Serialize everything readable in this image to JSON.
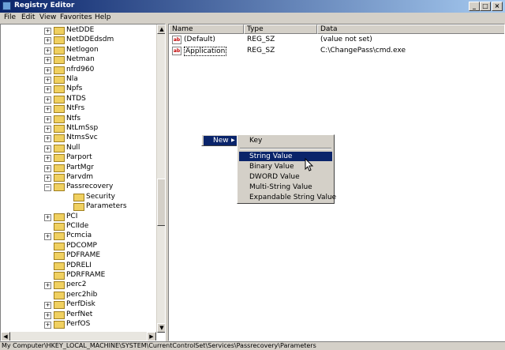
{
  "window": {
    "title": "Registry Editor",
    "minimize": "_",
    "maximize": "□",
    "close": "×"
  },
  "menu": {
    "file": "File",
    "edit": "Edit",
    "view": "View",
    "favorites": "Favorites",
    "help": "Help"
  },
  "tree": {
    "items": [
      {
        "label": "NetDDE",
        "exp": "+"
      },
      {
        "label": "NetDDEdsdm",
        "exp": "+"
      },
      {
        "label": "Netlogon",
        "exp": "+"
      },
      {
        "label": "Netman",
        "exp": "+"
      },
      {
        "label": "nfrd960",
        "exp": "+"
      },
      {
        "label": "Nla",
        "exp": "+"
      },
      {
        "label": "Npfs",
        "exp": "+"
      },
      {
        "label": "NTDS",
        "exp": "+"
      },
      {
        "label": "NtFrs",
        "exp": "+"
      },
      {
        "label": "Ntfs",
        "exp": "+"
      },
      {
        "label": "NtLmSsp",
        "exp": "+"
      },
      {
        "label": "NtmsSvc",
        "exp": "+"
      },
      {
        "label": "Null",
        "exp": "+"
      },
      {
        "label": "Parport",
        "exp": "+"
      },
      {
        "label": "PartMgr",
        "exp": "+"
      },
      {
        "label": "Parvdm",
        "exp": "+"
      },
      {
        "label": "Passrecovery",
        "exp": "−"
      },
      {
        "label": "Security",
        "exp": ""
      },
      {
        "label": "Parameters",
        "exp": ""
      },
      {
        "label": "PCI",
        "exp": "+"
      },
      {
        "label": "PCIIde",
        "exp": ""
      },
      {
        "label": "Pcmcia",
        "exp": "+"
      },
      {
        "label": "PDCOMP",
        "exp": ""
      },
      {
        "label": "PDFRAME",
        "exp": ""
      },
      {
        "label": "PDRELI",
        "exp": ""
      },
      {
        "label": "PDRFRAME",
        "exp": ""
      },
      {
        "label": "perc2",
        "exp": "+"
      },
      {
        "label": "perc2hib",
        "exp": ""
      },
      {
        "label": "PerfDisk",
        "exp": "+"
      },
      {
        "label": "PerfNet",
        "exp": "+"
      },
      {
        "label": "PerfOS",
        "exp": "+"
      }
    ]
  },
  "list": {
    "headers": {
      "name": "Name",
      "type": "Type",
      "data": "Data"
    },
    "rows": [
      {
        "icon": "ab",
        "name": "(Default)",
        "type": "REG_SZ",
        "data": "(value not set)"
      },
      {
        "icon": "ab",
        "name": "Application",
        "type": "REG_SZ",
        "data": "C:\\ChangePass\\cmd.exe"
      }
    ]
  },
  "context": {
    "new_label": "New",
    "arrow": "▶",
    "submenu": [
      "Key",
      "String Value",
      "Binary Value",
      "DWORD Value",
      "Multi-String Value",
      "Expandable String Value"
    ]
  },
  "status": {
    "path": "My Computer\\HKEY_LOCAL_MACHINE\\SYSTEM\\CurrentControlSet\\Services\\Passrecovery\\Parameters"
  },
  "colors": {
    "title_active": "#0a246a",
    "selection": "#0a246a",
    "face": "#d4d0c8"
  }
}
